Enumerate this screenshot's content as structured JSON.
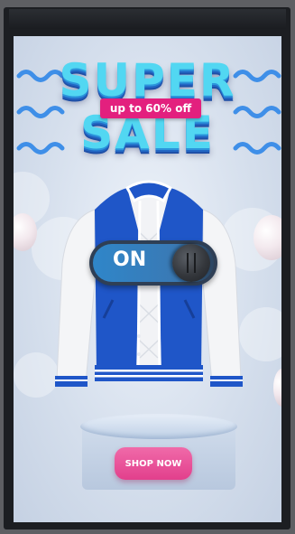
{
  "banner": {
    "title_line1": "SUPER",
    "title_line2": "SALE",
    "promo": "up to 60% off"
  },
  "toggle": {
    "label": "ON",
    "state": "on"
  },
  "cta": {
    "label": "SHOP NOW"
  },
  "colors": {
    "title": "#52d7f2",
    "promo_bg": "#e3207e",
    "button": "#e74f93",
    "jacket": "#1f56c8",
    "toggle_track": "#2f86c9"
  }
}
